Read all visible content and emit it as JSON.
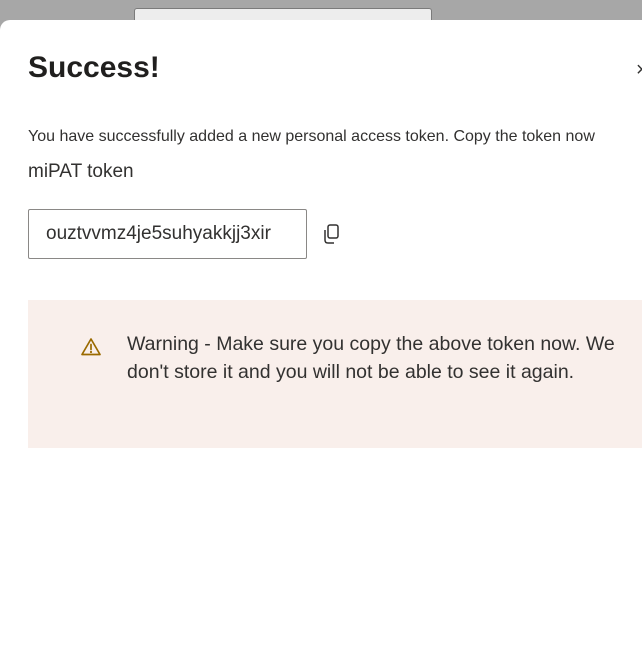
{
  "dialog": {
    "title": "Success!",
    "close_icon": "close-icon",
    "close_glyph": "×",
    "description": "You have successfully added a new personal access token. Copy the token now",
    "token_label": "miPAT token",
    "token_value": "ouztvvmz4je5suhyakkjj3xir",
    "copy_icon": "copy-icon"
  },
  "warning": {
    "icon": "warning-icon",
    "text": "Warning - Make sure you copy the above token now. We don't store it and you will not be able to see it again.",
    "colors": {
      "background": "#f9efeb",
      "icon": "#9a6a00"
    }
  },
  "colors": {
    "overlay": "#a7a7a7",
    "panel": "#ffffff",
    "text": "#323130"
  }
}
